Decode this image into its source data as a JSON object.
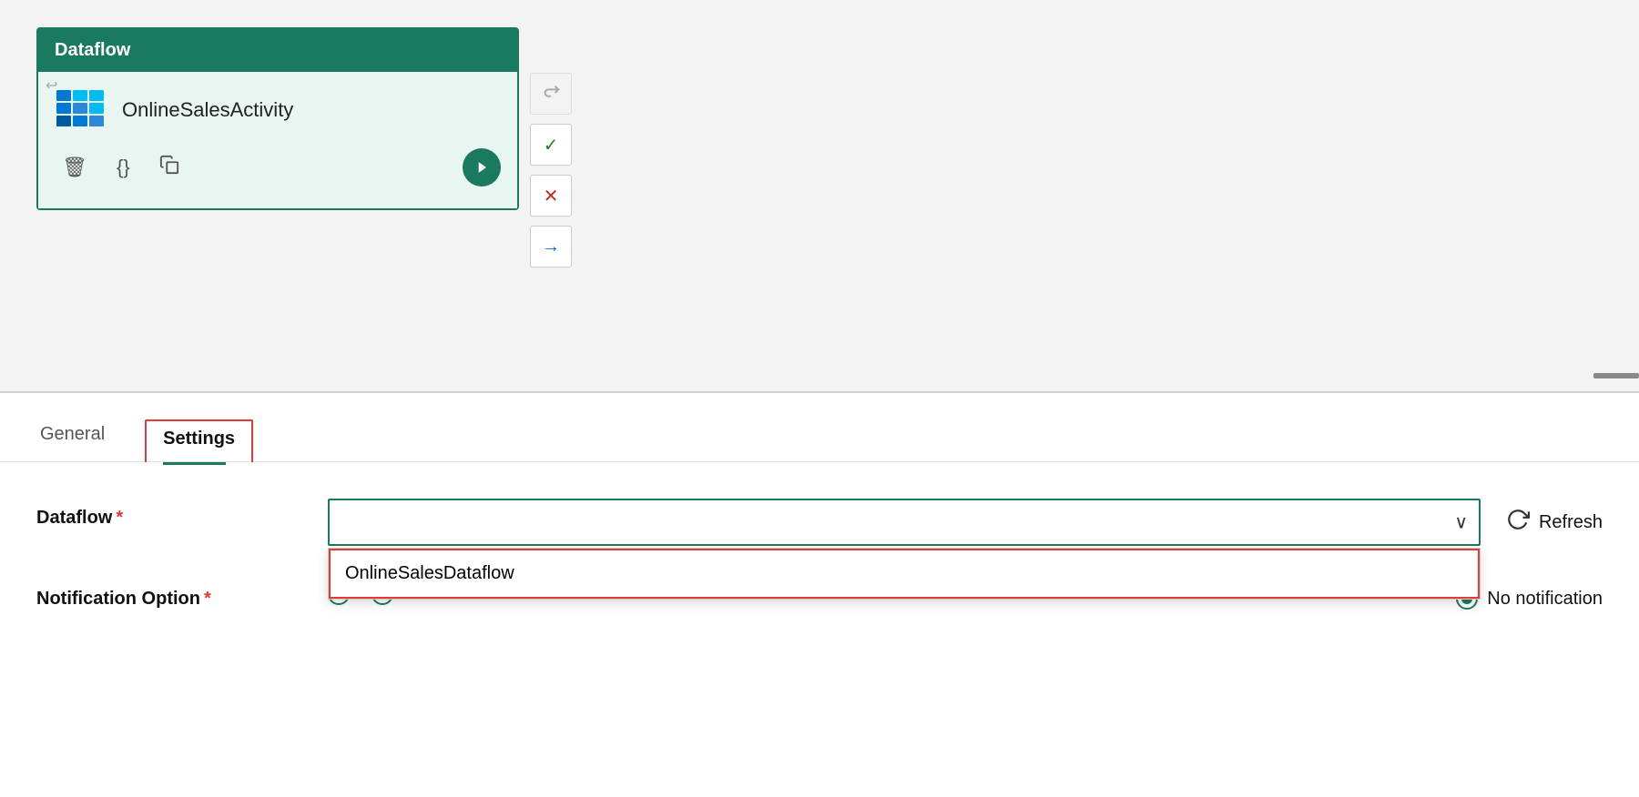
{
  "canvas": {
    "card": {
      "title": "Dataflow",
      "activity": {
        "name": "OnlineSalesActivity",
        "redo_icon": "↩",
        "delete_icon": "🗑",
        "braces_icon": "{}",
        "copy_icon": "⧉",
        "go_icon": "→"
      }
    },
    "toolbar": {
      "redo_icon": "↩",
      "check_icon": "✓",
      "close_icon": "✕",
      "arrow_icon": "→"
    }
  },
  "bottom_panel": {
    "tabs": [
      {
        "id": "general",
        "label": "General",
        "active": false
      },
      {
        "id": "settings",
        "label": "Settings",
        "active": true
      }
    ],
    "form": {
      "dataflow_label": "Dataflow",
      "dataflow_required": "*",
      "dataflow_value": "",
      "dataflow_placeholder": "",
      "dropdown_chevron": "∨",
      "dropdown_item": "OnlineSalesDataflow",
      "refresh_label": "Refresh",
      "notification_label": "Notification Option",
      "notification_required": "*",
      "no_notification_label": "No notification"
    }
  }
}
